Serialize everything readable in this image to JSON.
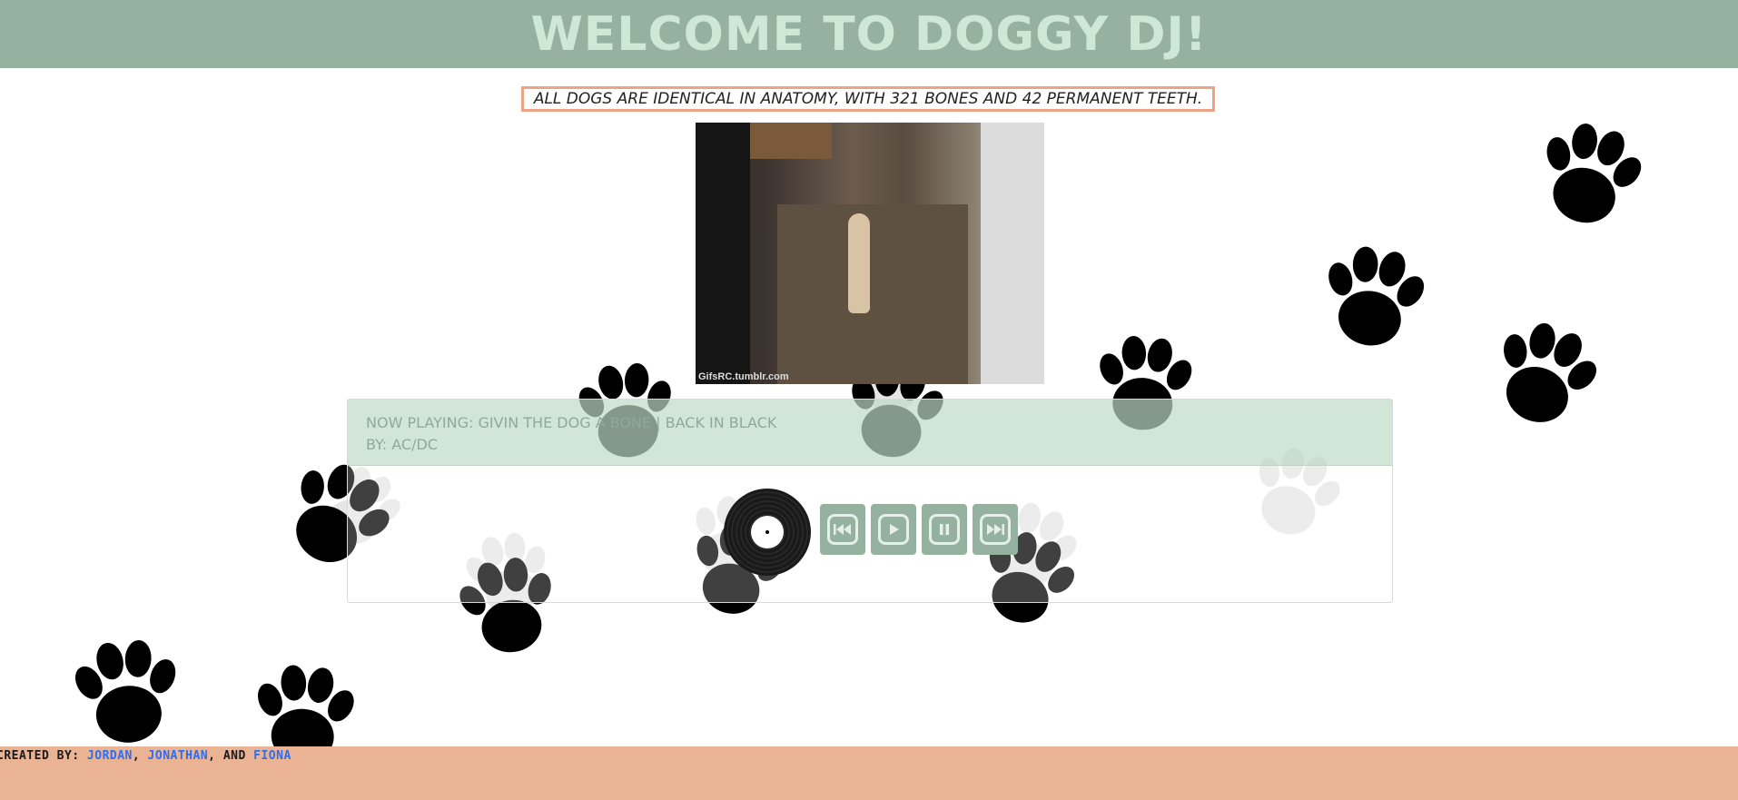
{
  "header": {
    "title": "WELCOME TO DOGGY DJ!"
  },
  "fact": {
    "text": "ALL DOGS ARE IDENTICAL IN ANATOMY, WITH 321 BONES AND 42 PERMANENT TEETH."
  },
  "image": {
    "credit": "GifsRC.tumblr.com"
  },
  "player": {
    "now_playing": "NOW PLAYING: GIVIN THE DOG A BONE | BACK IN BLACK",
    "artist": "BY: AC/DC",
    "buttons": {
      "prev_icon": "skip-back-icon",
      "play_icon": "play-icon",
      "pause_icon": "pause-icon",
      "next_icon": "fast-forward-icon"
    }
  },
  "footer": {
    "prefix": "CREATED BY: ",
    "names": [
      "JORDAN",
      "JONATHAN",
      "FIONA"
    ],
    "sep1": ", ",
    "sep2": ", AND "
  },
  "colors": {
    "header_bg": "#95b2a0",
    "header_text": "#cfe7d5",
    "fact_border": "#eea484",
    "footer_bg": "#e9b394",
    "link": "#2d6df0"
  }
}
